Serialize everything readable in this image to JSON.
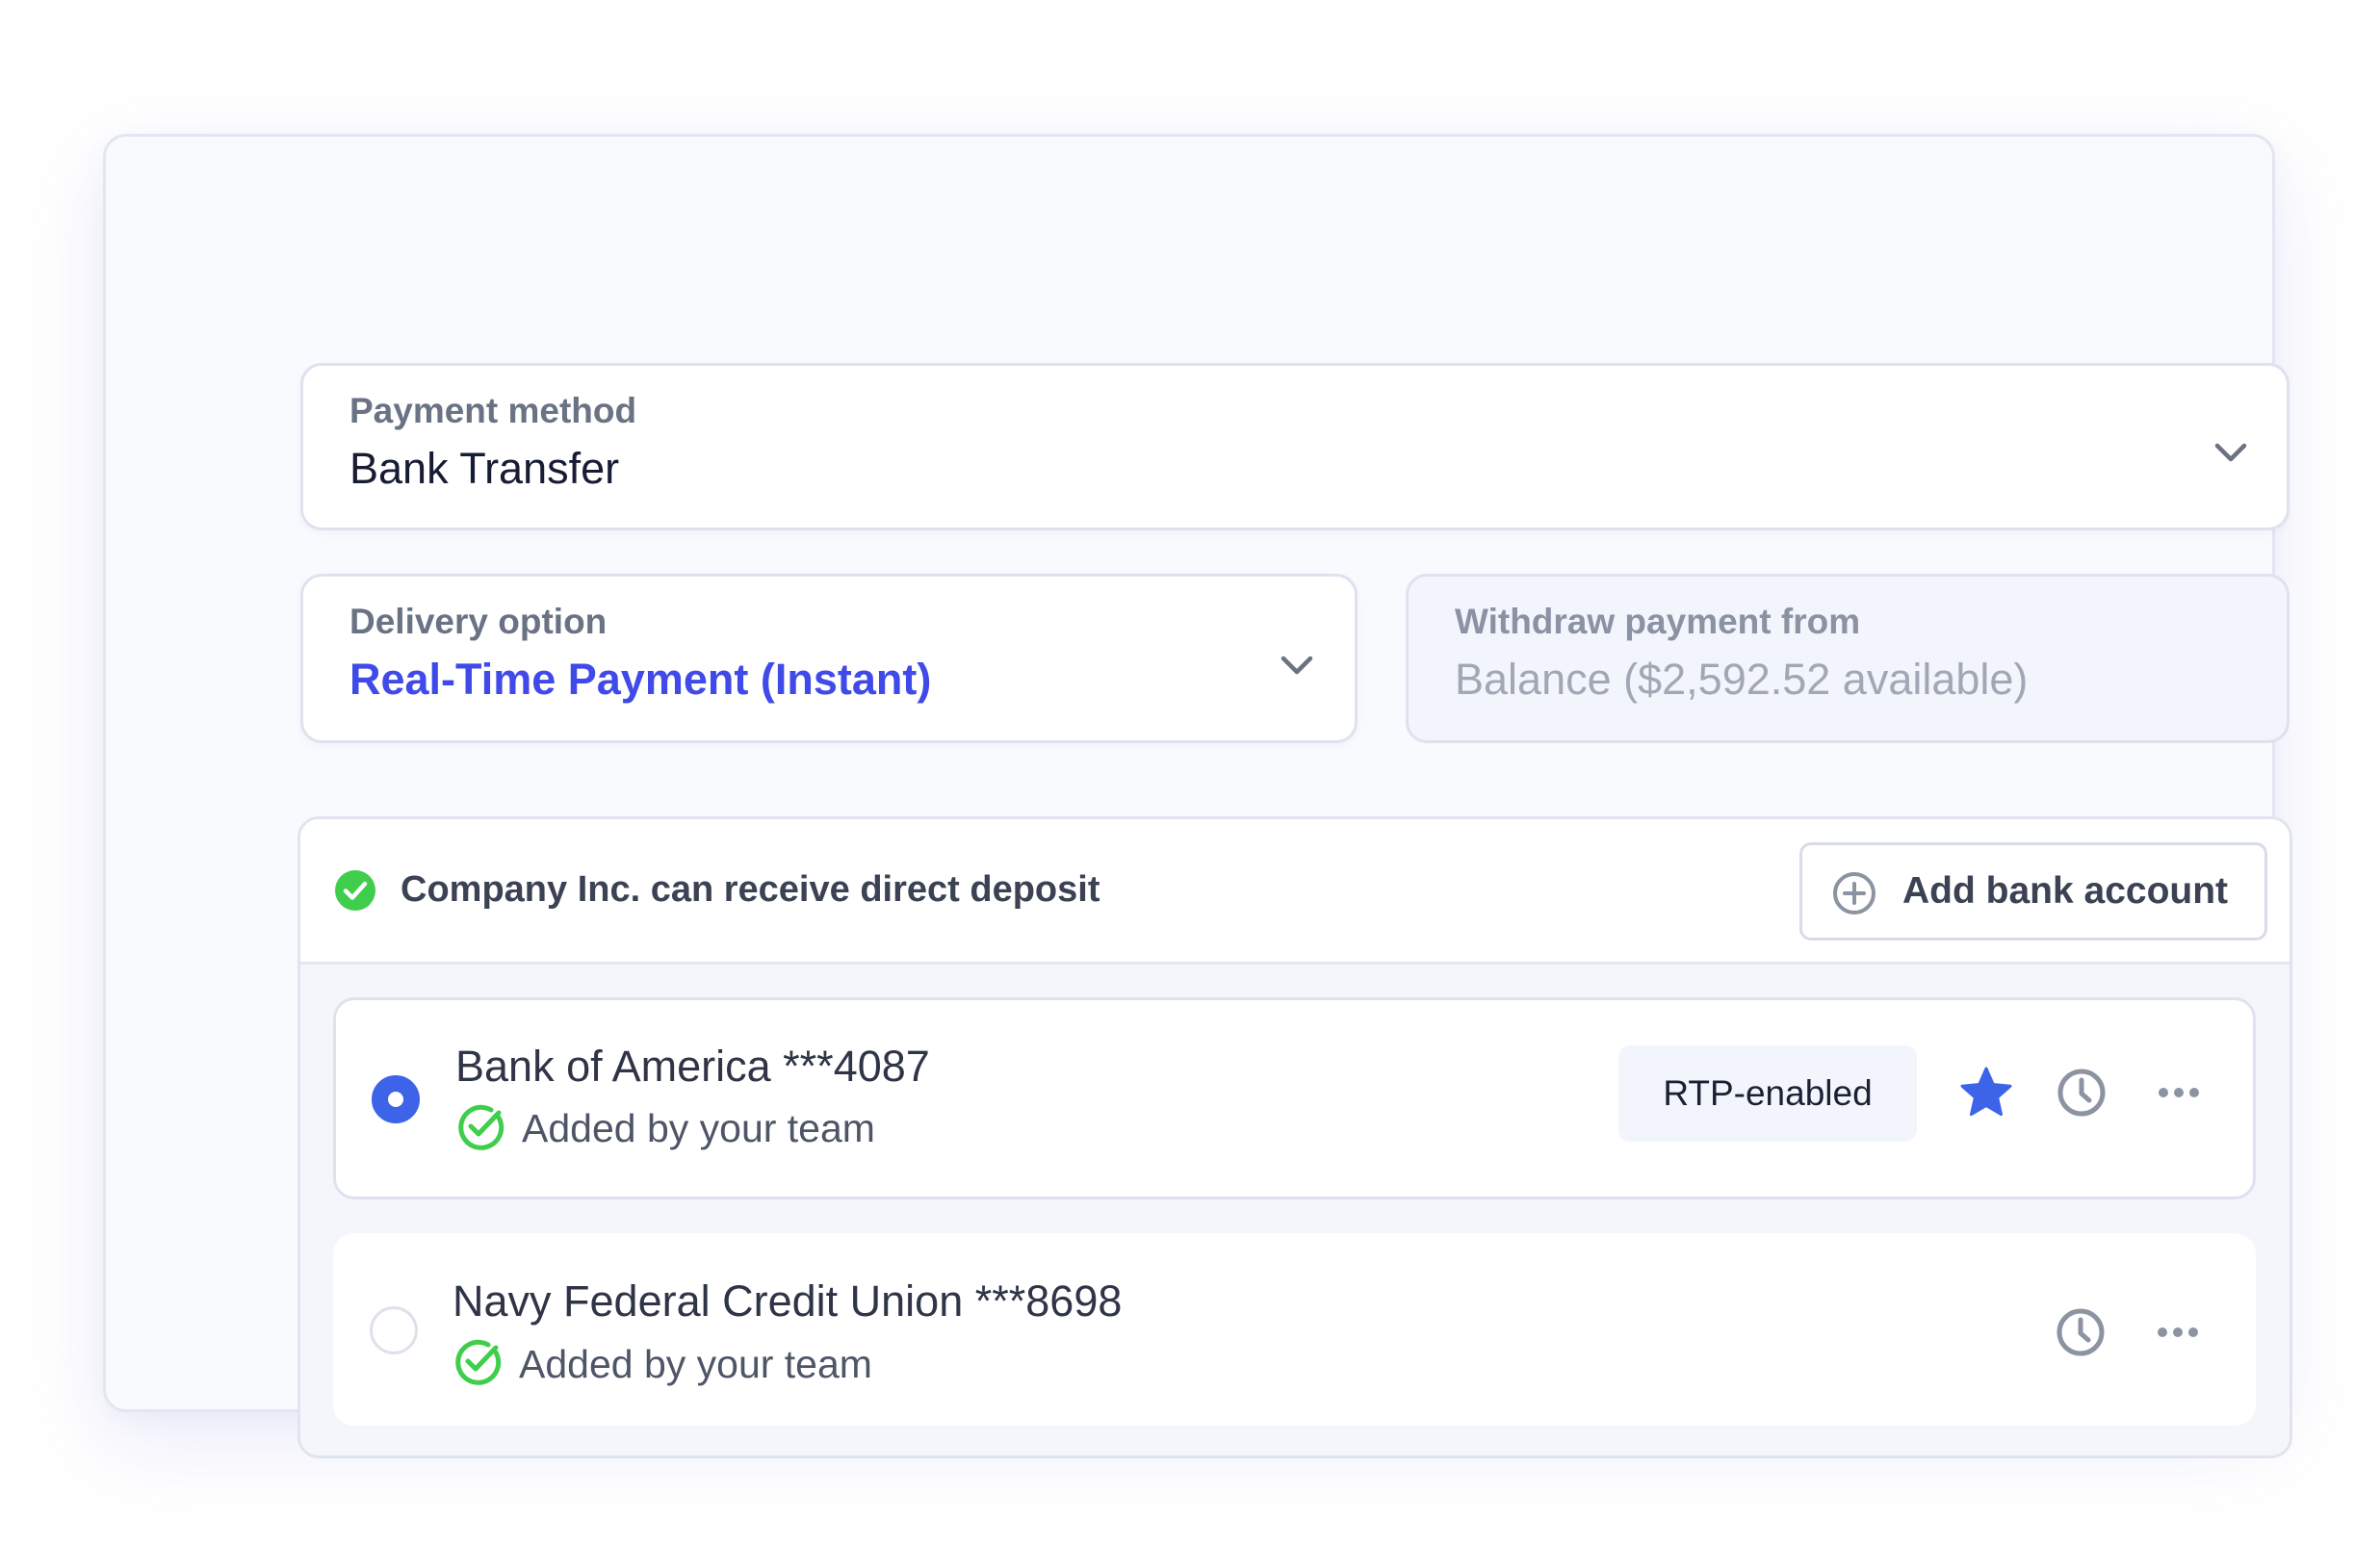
{
  "payment_method": {
    "label": "Payment method",
    "value": "Bank Transfer",
    "icon": "chevron-down-icon"
  },
  "delivery_option": {
    "label": "Delivery option",
    "value": "Real-Time Payment (Instant)",
    "icon": "chevron-down-icon"
  },
  "withdraw_from": {
    "label": "Withdraw payment from",
    "value": "Balance ($2,592.52 available)"
  },
  "deposit_status": {
    "text": "Company Inc. can receive direct deposit",
    "icon": "check-circle-icon"
  },
  "add_bank_button": {
    "label": "Add bank account",
    "icon": "plus-circle-icon"
  },
  "accounts": [
    {
      "name": "Bank of America ***4087",
      "status": "Added by your team",
      "selected": true,
      "badge": "RTP-enabled",
      "starred": true,
      "actions": [
        "star-icon",
        "history-icon",
        "more-icon"
      ]
    },
    {
      "name": "Navy Federal Credit Union ***8698",
      "status": "Added by your team",
      "selected": false,
      "actions": [
        "history-icon",
        "more-icon"
      ]
    }
  ],
  "colors": {
    "accent_blue": "#3f4ae8",
    "radio_blue": "#3d63e8",
    "success_green": "#3fcd4c",
    "icon_gray": "#8c93a1"
  }
}
